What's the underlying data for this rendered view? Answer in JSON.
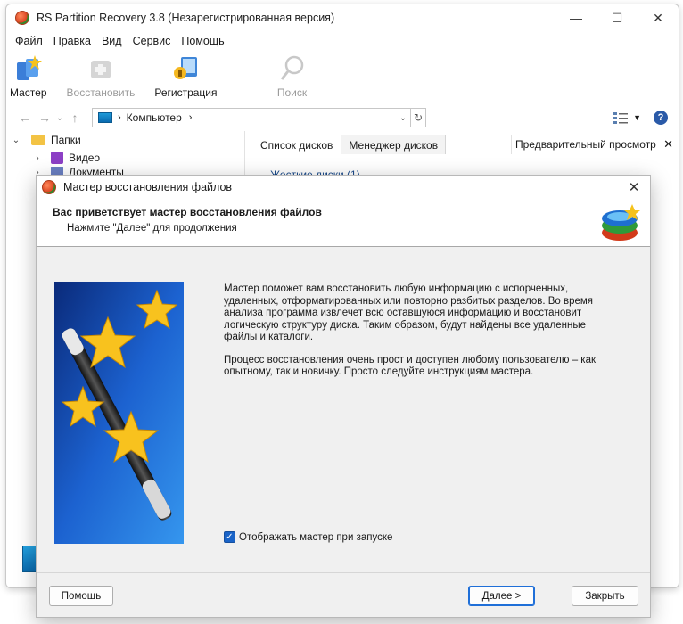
{
  "window": {
    "title": "RS Partition Recovery 3.8 (Незарегистрированная версия)",
    "controls": {
      "minimize": "—",
      "maximize": "☐",
      "close": "✕"
    }
  },
  "menu": [
    "Файл",
    "Правка",
    "Вид",
    "Сервис",
    "Помощь"
  ],
  "toolbar": [
    {
      "label": "Мастер",
      "icon": "wizard-icon",
      "enabled": true
    },
    {
      "label": "Восстановить",
      "icon": "restore-icon",
      "enabled": false
    },
    {
      "label": "Регистрация",
      "icon": "registration-icon",
      "enabled": true
    },
    {
      "label": "Поиск",
      "icon": "search-icon",
      "enabled": false
    }
  ],
  "address": {
    "location": "Компьютер"
  },
  "tree": {
    "items": [
      {
        "label": "Папки",
        "icon": "folder-icon"
      },
      {
        "label": "Видео",
        "icon": "video-icon"
      },
      {
        "label": "Документы",
        "icon": "documents-icon"
      }
    ]
  },
  "tabs": [
    {
      "label": "Список дисков",
      "active": true
    },
    {
      "label": "Менеджер дисков",
      "active": false
    }
  ],
  "preview": {
    "title": "Предварительный просмотр"
  },
  "disks": {
    "group_header": "Жесткие диски (1)"
  },
  "dialog": {
    "title": "Мастер восстановления файлов",
    "header_title": "Вас приветствует мастер восстановления файлов",
    "header_subtitle": "Нажмите \"Далее\" для продолжения",
    "paragraph1": "Мастер поможет вам восстановить любую информацию с испорченных, удаленных, отформатированных или повторно разбитых разделов. Во время анализа программа извлечет всю оставшуюся информацию и восстановит логическую структуру диска. Таким образом, будут найдены все удаленные файлы и каталоги.",
    "paragraph2": "Процесс восстановления очень прост и доступен любому пользователю – как опытному, так и новичку. Просто следуйте инструкциям мастера.",
    "checkbox_label": "Отображать мастер при запуске",
    "checkbox_checked": true,
    "buttons": {
      "help": "Помощь",
      "next": "Далее >",
      "close": "Закрыть"
    }
  },
  "colors": {
    "accent": "#1a64c8",
    "primary_button_border": "#1f6fd8"
  }
}
